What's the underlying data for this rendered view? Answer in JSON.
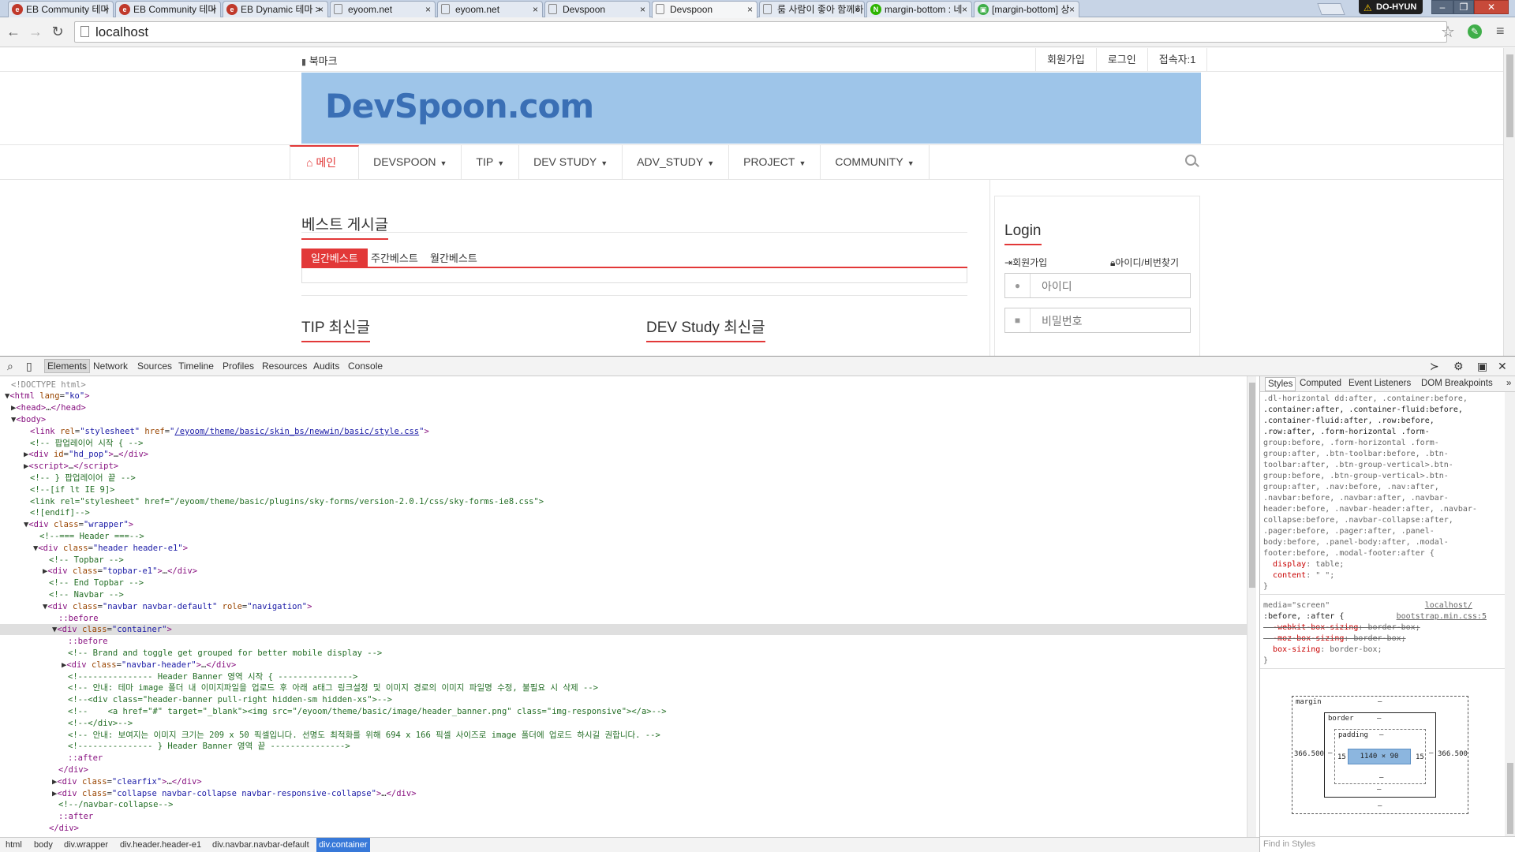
{
  "browser": {
    "tabs": [
      {
        "label": "EB Community 테마",
        "icon": "e",
        "iconColor": "#c0392b"
      },
      {
        "label": "EB Community 테마",
        "icon": "e",
        "iconColor": "#c0392b"
      },
      {
        "label": "EB Dynamic 테마 >",
        "icon": "e",
        "iconColor": "#c0392b"
      },
      {
        "label": "eyoom.net",
        "icon": "",
        "iconColor": ""
      },
      {
        "label": "eyoom.net",
        "icon": "",
        "iconColor": ""
      },
      {
        "label": "Devspoon",
        "icon": "",
        "iconColor": ""
      },
      {
        "label": "Devspoon",
        "icon": "",
        "iconColor": ""
      },
      {
        "label": "룸 사람이 좋아 함께하",
        "icon": "",
        "iconColor": ""
      },
      {
        "label": "margin-bottom : 네",
        "icon": "N",
        "iconColor": "#2db400"
      },
      {
        "label": "[margin-bottom] 상",
        "icon": "▣",
        "iconColor": "#3fae49"
      }
    ],
    "user": "DO-HYUN",
    "address": "localhost"
  },
  "page": {
    "bookmark": "북마크",
    "topbar_links": [
      "회원가입",
      "로그인",
      "접속자:1"
    ],
    "logo": "DevSpoon.com",
    "nav": [
      "메인",
      "DEVSPOON",
      "TIP",
      "DEV STUDY",
      "ADV_STUDY",
      "PROJECT",
      "COMMUNITY"
    ],
    "best_title": "베스트 게시글",
    "best_tabs": [
      "일간베스트",
      "주간베스트",
      "월간베스트"
    ],
    "tip_title": "TIP 최신글",
    "devstudy_title": "DEV Study 최신글",
    "login": {
      "title": "Login",
      "signup": "회원가입",
      "find": "아이디/비번찾기",
      "id_placeholder": "아이디",
      "pw_placeholder": "비밀번호"
    }
  },
  "devtools": {
    "tabs": [
      "Elements",
      "Network",
      "Sources",
      "Timeline",
      "Profiles",
      "Resources",
      "Audits",
      "Console"
    ],
    "breadcrumbs": [
      "html",
      "body",
      "div.wrapper",
      "div.header.header-e1",
      "div.navbar.navbar-default",
      "div.container"
    ],
    "styles_tabs": [
      "Styles",
      "Computed",
      "Event Listeners",
      "DOM Breakpoints"
    ],
    "find_placeholder": "Find in Styles",
    "box_model": {
      "margin_label": "margin",
      "border_label": "border",
      "padding_label": "padding",
      "content": "1140 × 90",
      "margin_left": "366.500",
      "margin_right": "366.500",
      "padding_left": "15",
      "padding_right": "15",
      "dash": "–"
    }
  }
}
